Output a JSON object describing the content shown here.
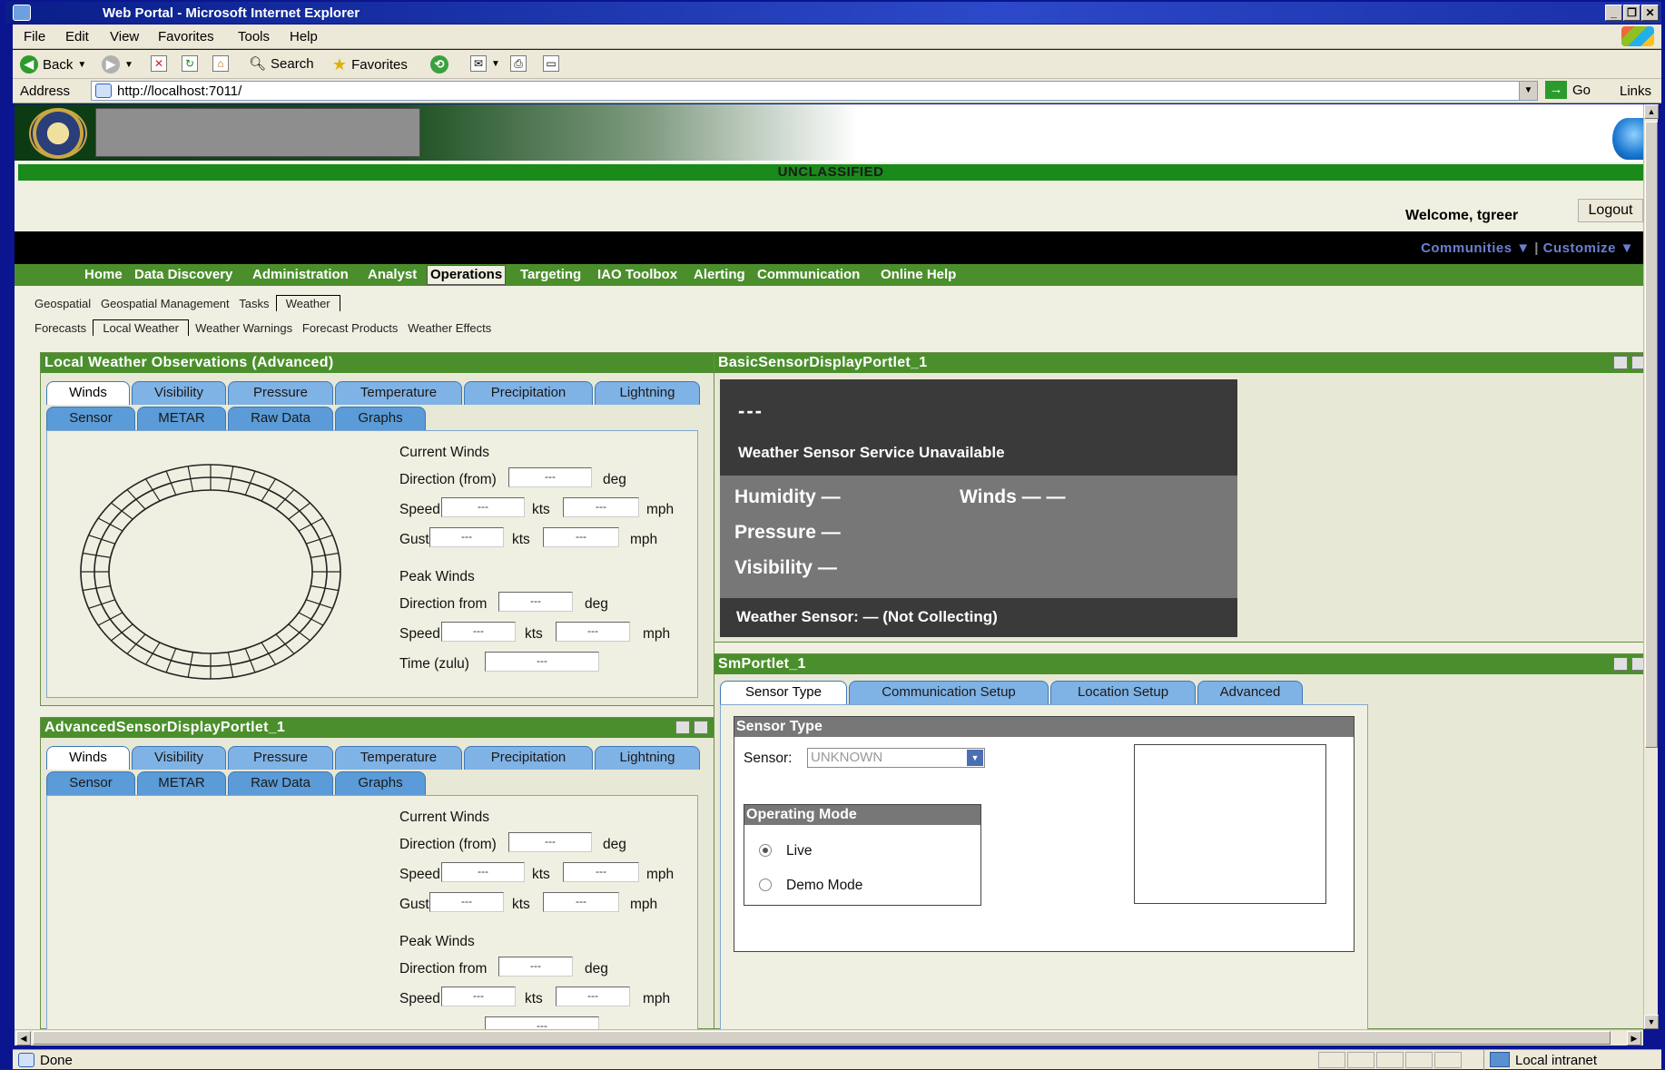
{
  "window": {
    "title": "Web Portal - Microsoft Internet Explorer"
  },
  "menu": [
    "File",
    "Edit",
    "View",
    "Favorites",
    "Tools",
    "Help"
  ],
  "toolbar": {
    "back": "Back",
    "search": "Search",
    "favorites": "Favorites"
  },
  "address": {
    "label": "Address",
    "url": "http://localhost:7011/",
    "go": "Go",
    "links": "Links"
  },
  "portal": {
    "classification": "UNCLASSIFIED",
    "welcome": "Welcome, tgreer",
    "logout": "Logout",
    "communities": "Communities",
    "customize": "Customize"
  },
  "nav": [
    "Home",
    "Data Discovery",
    "Administration",
    "Analyst",
    "Operations",
    "Targeting",
    "IAO Toolbox",
    "Alerting",
    "Communication",
    "Online Help"
  ],
  "subnav1": [
    "Geospatial",
    "Geospatial Management",
    "Tasks",
    "Weather"
  ],
  "subnav2": [
    "Forecasts",
    "Local Weather",
    "Weather Warnings",
    "Forecast Products",
    "Weather Effects"
  ],
  "tabs_row1": [
    "Winds",
    "Visibility",
    "Pressure",
    "Temperature",
    "Precipitation",
    "Lightning"
  ],
  "tabs_row2": [
    "Sensor",
    "METAR",
    "Raw Data",
    "Graphs"
  ],
  "winds": {
    "current": "Current Winds",
    "direction_from": "Direction (from)",
    "speed": "Speed",
    "gust": "Gust",
    "peak": "Peak Winds",
    "peak_direction": "Direction from",
    "time": "Time (zulu)",
    "deg": "deg",
    "kts": "kts",
    "mph": "mph",
    "empty": "---"
  },
  "panels": {
    "local": "Local Weather Observations (Advanced)",
    "advanced": "AdvancedSensorDisplayPortlet_1",
    "basic": "BasicSensorDisplayPortlet_1",
    "sm": "SmPortlet_1"
  },
  "basic": {
    "dashes": "---",
    "unavailable": "Weather Sensor Service Unavailable",
    "humidity": "Humidity —",
    "winds": "Winds — —",
    "pressure": "Pressure —",
    "visibility": "Visibility —",
    "sensor": "Weather Sensor: — (Not Collecting)"
  },
  "sm": {
    "tabs": [
      "Sensor Type",
      "Communication Setup",
      "Location Setup",
      "Advanced"
    ],
    "section": "Sensor Type",
    "sensor_label": "Sensor:",
    "sensor_value": "UNKNOWN",
    "mode_title": "Operating Mode",
    "live": "Live",
    "demo": "Demo Mode"
  },
  "status": {
    "text": "Done",
    "zone": "Local intranet"
  }
}
